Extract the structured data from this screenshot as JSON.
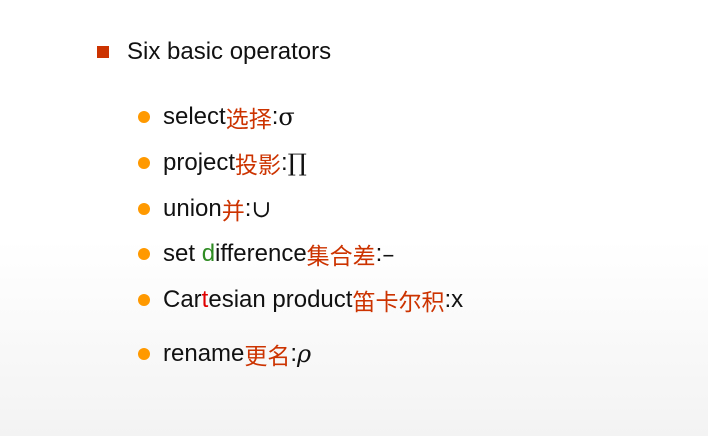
{
  "heading": "Six basic operators",
  "colors": {
    "square": "#cc3300",
    "bullet": "#ff9900",
    "chinese": "#cc3300",
    "highlight_d": "#2e8b22",
    "highlight_t": "#e00000"
  },
  "items": [
    {
      "en": "select",
      "cn": "选择",
      "sep": ": ",
      "sym": "σ"
    },
    {
      "en": "project",
      "cn": "投影",
      "sep": ": ",
      "sym": "∏"
    },
    {
      "en": "union",
      "cn": "并",
      "sep": ": ",
      "sym": "∪"
    },
    {
      "en_a": "set ",
      "en_hl": "d",
      "en_b": "ifference",
      "cn": "集合差",
      "sep": ": ",
      "sym": "–"
    },
    {
      "en_a": "Car",
      "en_hl": "t",
      "en_b": "esian product",
      "cn": "笛卡尔积",
      "sep": ": ",
      "sym": "x"
    },
    {
      "en": "rename",
      "cn": "更名",
      "sep": ": ",
      "sym": "ρ"
    }
  ]
}
